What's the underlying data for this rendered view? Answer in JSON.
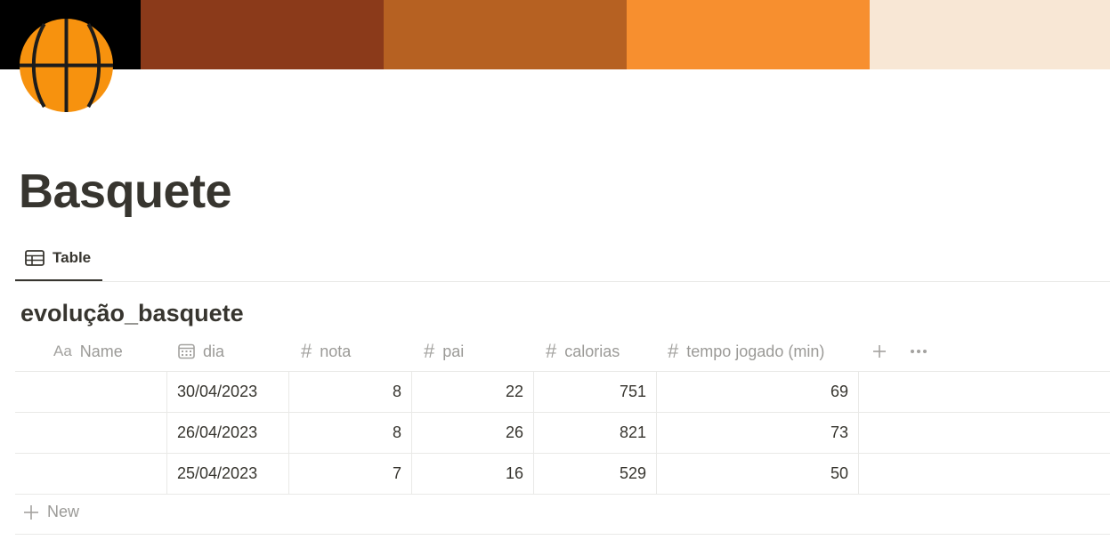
{
  "cover": {
    "colors": [
      "#000000",
      "#8b3a1a",
      "#b66122",
      "#f78f2f",
      "#f8e7d5"
    ]
  },
  "page": {
    "icon": "basketball-icon",
    "title": "Basquete"
  },
  "tabs": [
    {
      "label": "Table",
      "icon": "table-icon",
      "active": true
    }
  ],
  "database": {
    "title": "evolução_basquete",
    "columns": [
      {
        "label": "Name",
        "icon": "text-type-icon"
      },
      {
        "label": "dia",
        "icon": "calendar-icon"
      },
      {
        "label": "nota",
        "icon": "number-icon"
      },
      {
        "label": "pai",
        "icon": "number-icon"
      },
      {
        "label": "calorias",
        "icon": "number-icon"
      },
      {
        "label": "tempo jogado (min)",
        "icon": "number-icon"
      }
    ],
    "rows": [
      {
        "name": "",
        "dia": "30/04/2023",
        "nota": "8",
        "pai": "22",
        "calorias": "751",
        "tempo": "69"
      },
      {
        "name": "",
        "dia": "26/04/2023",
        "nota": "8",
        "pai": "26",
        "calorias": "821",
        "tempo": "73"
      },
      {
        "name": "",
        "dia": "25/04/2023",
        "nota": "7",
        "pai": "16",
        "calorias": "529",
        "tempo": "50"
      }
    ],
    "new_label": "New",
    "header_icons": {
      "text": "Aa",
      "number": "#"
    }
  }
}
